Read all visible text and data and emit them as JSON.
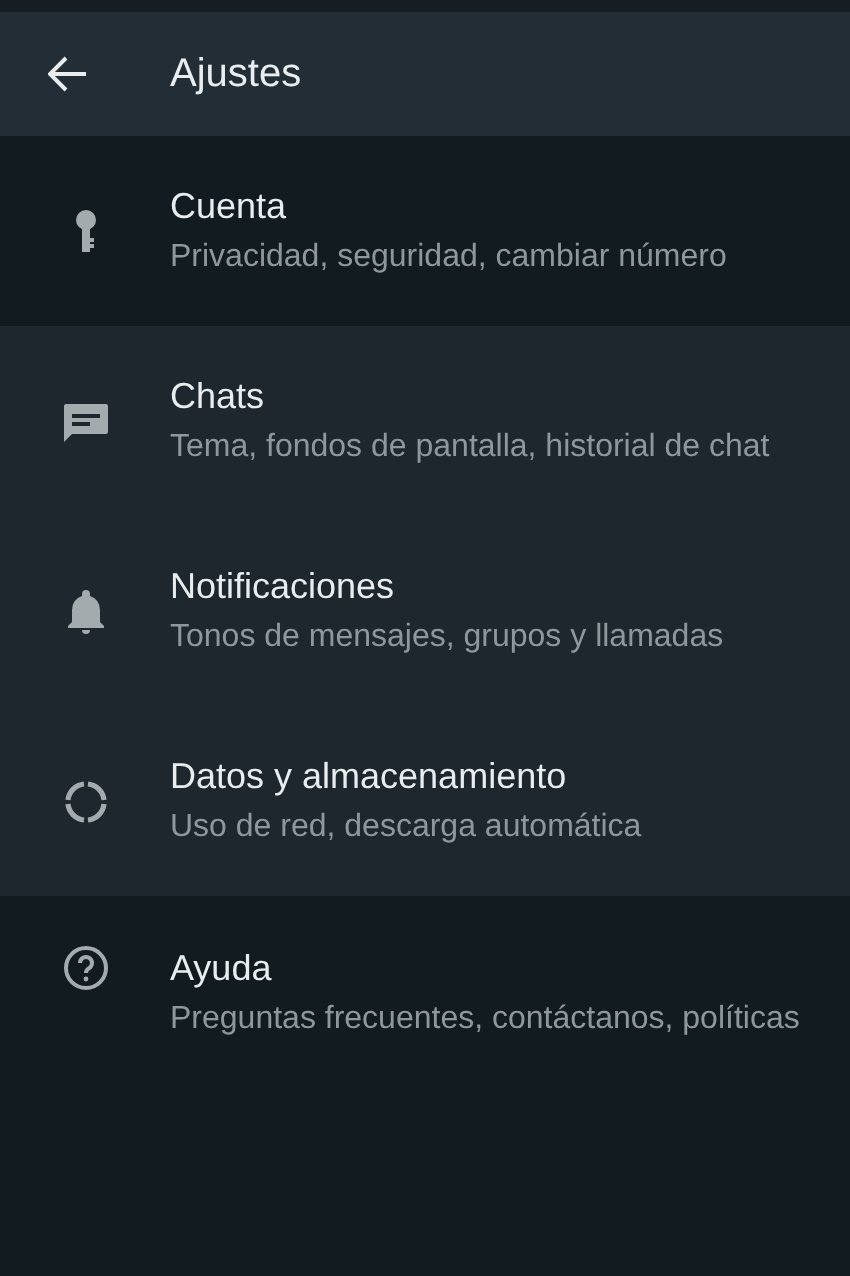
{
  "app_bar": {
    "title": "Ajustes"
  },
  "items": [
    {
      "kind": "key",
      "title": "Cuenta",
      "subtitle": "Privacidad, seguridad, cambiar número",
      "highlighted": true
    },
    {
      "kind": "chat",
      "title": "Chats",
      "subtitle": "Tema, fondos de pantalla, historial de chat",
      "highlighted": false
    },
    {
      "kind": "bell",
      "title": "Notificaciones",
      "subtitle": "Tonos de mensajes, grupos y llamadas",
      "highlighted": false
    },
    {
      "kind": "data",
      "title": "Datos y almacenamiento",
      "subtitle": "Uso de red, descarga automática",
      "highlighted": false
    },
    {
      "kind": "help",
      "title": "Ayuda",
      "subtitle": "Preguntas frecuentes, contáctanos, políticas",
      "highlighted": true
    }
  ]
}
